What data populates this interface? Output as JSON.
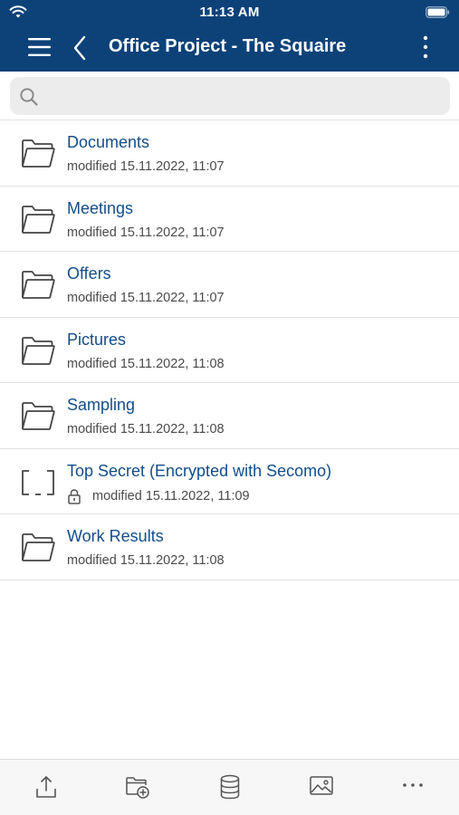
{
  "status_bar": {
    "time": "11:13 AM"
  },
  "nav": {
    "title": "Office Project - The Squaire"
  },
  "search": {
    "placeholder": "",
    "value": ""
  },
  "items": [
    {
      "name": "Documents",
      "modified": "modified 15.11.2022, 11:07",
      "type": "folder",
      "locked": false
    },
    {
      "name": "Meetings",
      "modified": "modified 15.11.2022, 11:07",
      "type": "folder",
      "locked": false
    },
    {
      "name": "Offers",
      "modified": "modified 15.11.2022, 11:07",
      "type": "folder",
      "locked": false
    },
    {
      "name": "Pictures",
      "modified": "modified 15.11.2022, 11:08",
      "type": "folder",
      "locked": false
    },
    {
      "name": "Sampling",
      "modified": "modified 15.11.2022, 11:08",
      "type": "folder",
      "locked": false
    },
    {
      "name": "Top Secret (Encrypted with Secomo)",
      "modified": "modified 15.11.2022, 11:09",
      "type": "encrypted-folder",
      "locked": true
    },
    {
      "name": "Work Results",
      "modified": "modified 15.11.2022, 11:08",
      "type": "folder",
      "locked": false
    }
  ],
  "toolbar": {
    "buttons": [
      "upload-icon",
      "new-folder-icon",
      "database-icon",
      "image-icon",
      "more-horizontal-icon"
    ]
  },
  "colors": {
    "brand": "#0d4279",
    "link": "#134d8a"
  }
}
